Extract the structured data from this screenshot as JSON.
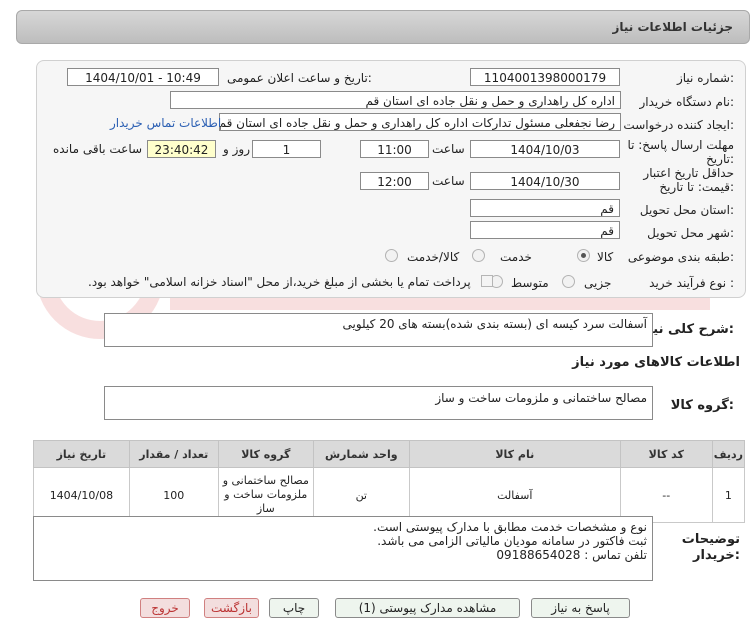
{
  "header": {
    "title": "جزئیات اطلاعات نیاز"
  },
  "form": {
    "need_number_label": "شماره نیاز:",
    "need_number": "1104001398000179",
    "announce_label": "تاریخ و ساعت اعلان عمومی:",
    "announce_value": "1404/10/01 - 10:49",
    "buyer_org_label": "نام دستگاه خریدار:",
    "buyer_org": "اداره کل راهداری و حمل و نقل جاده ای استان قم",
    "requester_label": "ایجاد کننده درخواست:",
    "requester": "رضا  نجفعلی مسئول تدارکات اداره کل راهداری و حمل و نقل جاده ای استان قم",
    "contact_link": "اطلاعات تماس خریدار",
    "deadline_label_1": "مهلت ارسال پاسخ: تا",
    "deadline_label_2": "تاریخ:",
    "deadline_date": "1404/10/03",
    "time_label": "ساعت",
    "deadline_time": "11:00",
    "days_value": "1",
    "days_label": "روز و",
    "remaining_time": "23:40:42",
    "remaining_label": "ساعت باقی مانده",
    "validity_label_1": "حداقل تاریخ اعتبار",
    "validity_label_2": "قیمت: تا تاریخ:",
    "validity_date": "1404/10/30",
    "validity_time": "12:00",
    "province_label": "استان محل تحویل:",
    "province": "قم",
    "city_label": "شهر محل تحویل:",
    "city": "قم",
    "category_label": "طبقه بندی موضوعی:",
    "category_options": [
      "کالا",
      "خدمت",
      "کالا/خدمت"
    ],
    "process_label": "نوع فرآیند خرید :",
    "process_options": [
      "جزیی",
      "متوسط"
    ],
    "payment_note": "پرداخت تمام یا بخشی از مبلغ خرید،از محل \"اسناد خزانه اسلامی\" خواهد بود."
  },
  "description": {
    "label": "شرح کلی نیاز:",
    "value": "آسفالت سرد کیسه ای (بسته بندی شده)بسته های 20 کیلویی"
  },
  "goods": {
    "section_title": "اطلاعات کالاهای مورد نیاز",
    "group_label": "گروه کالا:",
    "group_value": "مصالح ساختمانی و ملزومات ساخت و ساز",
    "columns": [
      "ردیف",
      "کد کالا",
      "نام کالا",
      "واحد شمارش",
      "گروه کالا",
      "تعداد / مقدار",
      "تاریخ نیاز"
    ],
    "rows": [
      {
        "row": "1",
        "code": "--",
        "name": "آسفالت",
        "unit": "تن",
        "group": "مصالح ساختمانی و ملزومات ساخت و ساز",
        "qty": "100",
        "date": "1404/10/08"
      }
    ]
  },
  "buyer_notes": {
    "label_1": "توضیحات",
    "label_2": "خریدار:",
    "line1": "نوع و مشخصات خدمت مطابق با مدارک پیوستی است.",
    "line2": "ثبت فاکتور در سامانه مودیان مالیاتی الزامی می باشد.",
    "line3": "تلفن تماس : 09188654028"
  },
  "buttons": {
    "reply": "پاسخ به نیاز",
    "attachments": "مشاهده مدارک پیوستی (1)",
    "print": "چاپ",
    "back": "بازگشت",
    "exit": "خروج"
  },
  "colors": {
    "link": "#2b5fb3",
    "highlight": "#ffffcc",
    "exit": "#b33333"
  }
}
